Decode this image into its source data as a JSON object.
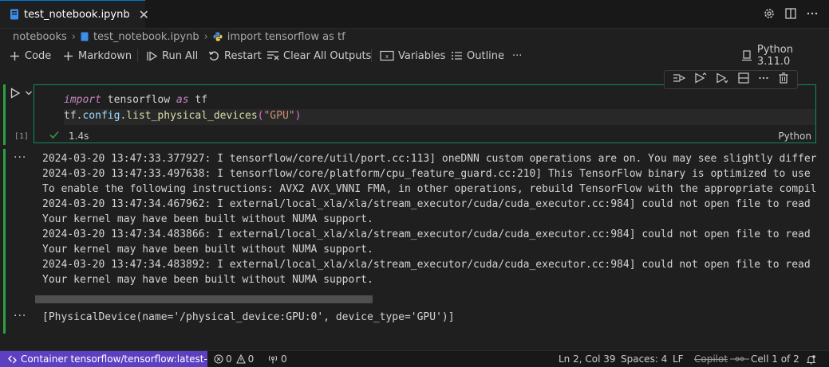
{
  "tab": {
    "title": "test_notebook.ipynb",
    "close": "✕"
  },
  "breadcrumb": [
    "notebooks",
    "test_notebook.ipynb",
    "import tensorflow as tf"
  ],
  "toolbar": {
    "code": "Code",
    "markdown": "Markdown",
    "run_all": "Run All",
    "restart": "Restart",
    "clear_outputs": "Clear All Outputs",
    "variables": "Variables",
    "outline": "Outline",
    "more": "···",
    "kernel": "Python 3.11.0"
  },
  "cell": {
    "exec_count": "[1]",
    "duration": "1.4s",
    "language": "Python",
    "code": {
      "l1_kw1": "import",
      "l1_mod": " tensorflow ",
      "l1_kw2": "as",
      "l1_alias": " tf",
      "l2_a": "tf",
      "l2_b": ".",
      "l2_c": "config",
      "l2_d": ".",
      "l2_fn": "list_physical_devices",
      "l2_open": "(",
      "l2_str": "\"GPU\"",
      "l2_close": ")"
    }
  },
  "outputs": {
    "stderr": [
      "2024-03-20 13:47:33.377927: I tensorflow/core/util/port.cc:113] oneDNN custom operations are on. You may see slightly differen",
      "2024-03-20 13:47:33.497638: I tensorflow/core/platform/cpu_feature_guard.cc:210] This TensorFlow binary is optimized to use av",
      "To enable the following instructions: AVX2 AVX_VNNI FMA, in other operations, rebuild TensorFlow with the appropriate compiler",
      "2024-03-20 13:47:34.467962: I external/local_xla/xla/stream_executor/cuda/cuda_executor.cc:984] could not open file to read NU",
      "Your kernel may have been built without NUMA support.",
      "2024-03-20 13:47:34.483866: I external/local_xla/xla/stream_executor/cuda/cuda_executor.cc:984] could not open file to read NU",
      "Your kernel may have been built without NUMA support.",
      "2024-03-20 13:47:34.483892: I external/local_xla/xla/stream_executor/cuda/cuda_executor.cc:984] could not open file to read NU",
      "Your kernel may have been built without NUMA support."
    ],
    "result": "[PhysicalDevice(name='/physical_device:GPU:0', device_type='GPU')]",
    "more": "···"
  },
  "statusbar": {
    "remote": "Container tensorflow/tensorflow:latest-g...",
    "errors": "0",
    "warnings": "0",
    "ports": "0",
    "position": "Ln 2, Col 39",
    "spaces": "Spaces: 4",
    "eol": "LF",
    "copilot": "Copilot",
    "cell": "Cell 1 of 2"
  },
  "colors": {
    "accent": "#0078d4",
    "cell_bar": "#2ea043",
    "remote": "#5d3fc1",
    "border": "#0f8a6a"
  }
}
